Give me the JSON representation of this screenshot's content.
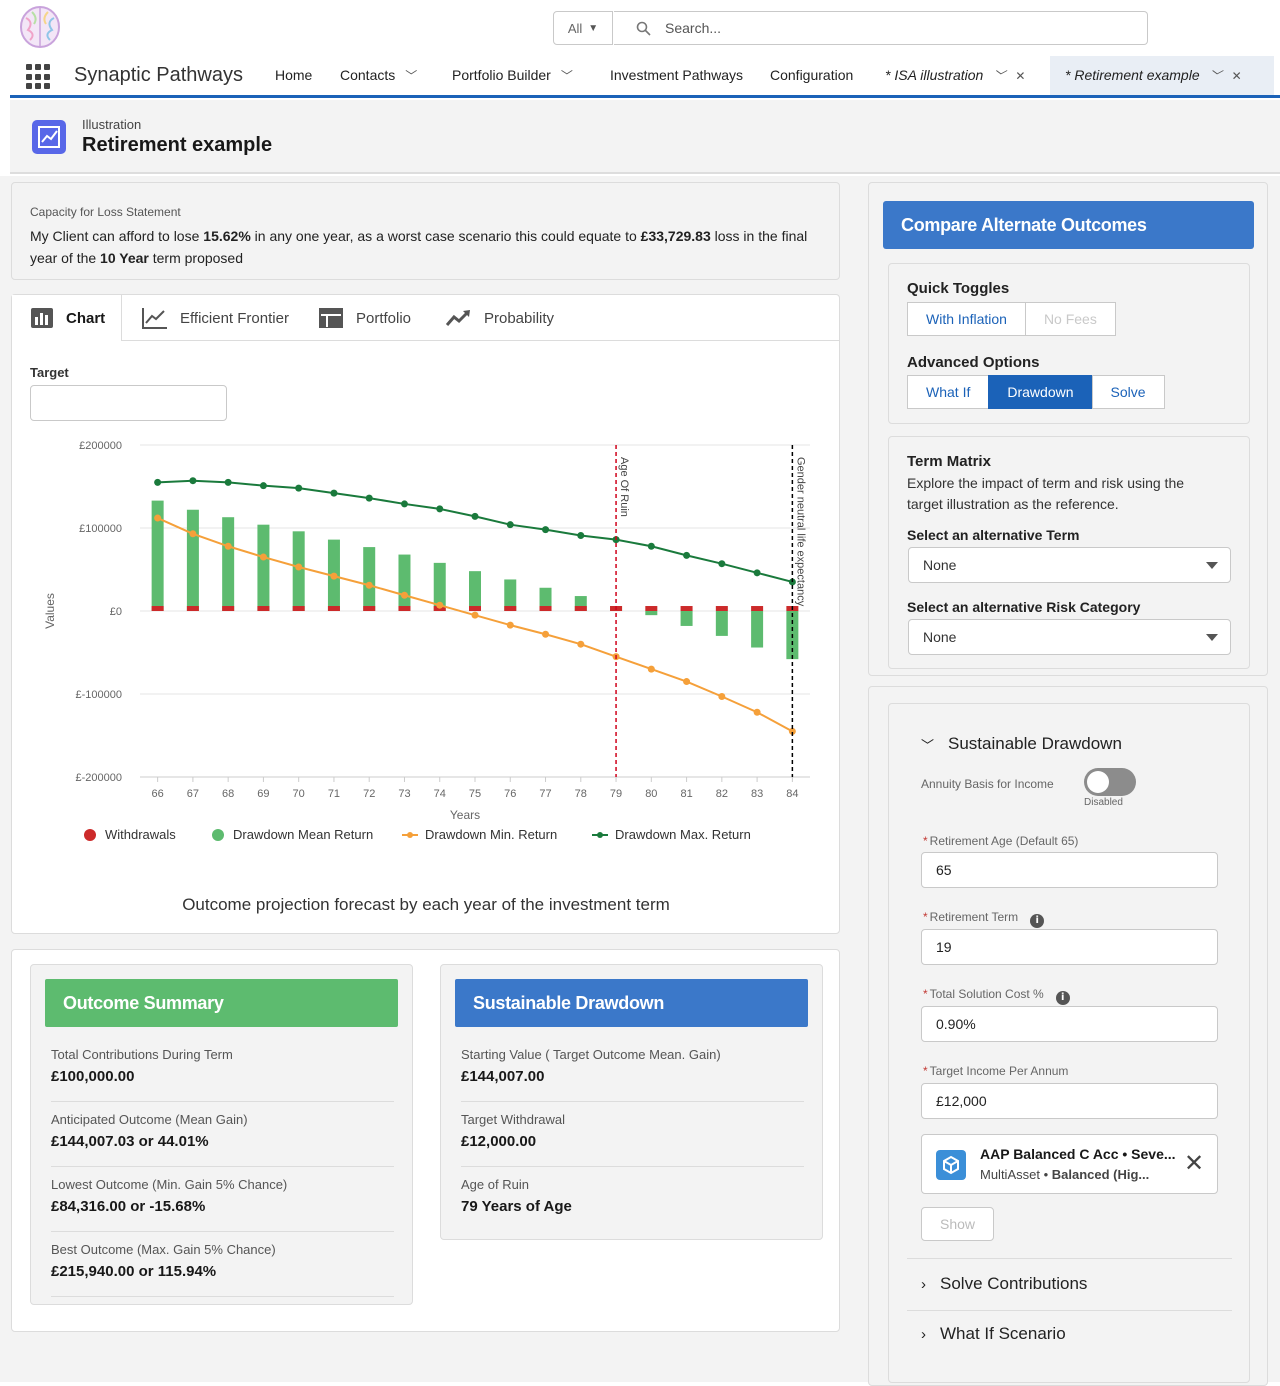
{
  "search": {
    "scope": "All",
    "placeholder": "Search..."
  },
  "nav": {
    "app_name": "Synaptic Pathways",
    "items": [
      {
        "label": "Home"
      },
      {
        "label": "Contacts"
      },
      {
        "label": "Portfolio Builder"
      },
      {
        "label": "Investment Pathways"
      },
      {
        "label": "Configuration"
      },
      {
        "label": "* ISA illustration"
      },
      {
        "label": "* Retirement example"
      }
    ]
  },
  "header": {
    "kicker": "Illustration",
    "title": "Retirement example"
  },
  "capacity": {
    "label": "Capacity for Loss Statement",
    "t1": "My Client can afford to lose ",
    "pct": "15.62%",
    "t2": " in any one year, as a worst case scenario this could equate to ",
    "amount": "£33,729.83",
    "t3": " loss in the final year of the ",
    "term": "10 Year",
    "t4": " term proposed"
  },
  "tabs": [
    {
      "label": "Chart",
      "icon": "bar-chart-icon"
    },
    {
      "label": "Efficient Frontier",
      "icon": "line-chart-icon"
    },
    {
      "label": "Portfolio",
      "icon": "table-icon"
    },
    {
      "label": "Probability",
      "icon": "trend-icon"
    }
  ],
  "target": {
    "label": "Target",
    "value": ""
  },
  "chart_data": {
    "type": "bar",
    "ylabel": "Values",
    "xlabel": "Years",
    "ylim": [
      -200000,
      200000
    ],
    "yticks": [
      200000,
      100000,
      0,
      -100000,
      -200000
    ],
    "ytick_labels": [
      "£200000",
      "£100000",
      "£0",
      "£-100000",
      "£-200000"
    ],
    "x": [
      66,
      67,
      68,
      69,
      70,
      71,
      72,
      73,
      74,
      75,
      76,
      77,
      78,
      79,
      80,
      81,
      82,
      83,
      84
    ],
    "series": [
      {
        "name": "Withdrawals",
        "type": "bar",
        "color": "#cc2a2a",
        "values": [
          6000,
          6000,
          6000,
          6000,
          6000,
          6000,
          6000,
          6000,
          6000,
          6000,
          6000,
          6000,
          6000,
          6000,
          6000,
          6000,
          6000,
          6000,
          6000
        ]
      },
      {
        "name": "Drawdown Mean Return",
        "type": "bar",
        "color": "#5dbb6f",
        "values": [
          133000,
          122000,
          113000,
          104000,
          96000,
          86000,
          77000,
          68000,
          58000,
          48000,
          38000,
          28000,
          18000,
          6000,
          -5000,
          -18000,
          -30000,
          -44000,
          -58000
        ]
      },
      {
        "name": "Drawdown Min. Return",
        "type": "line",
        "color": "#f5a03a",
        "values": [
          112000,
          93000,
          78000,
          65000,
          53000,
          42000,
          31000,
          19000,
          7000,
          -5000,
          -17000,
          -28000,
          -40000,
          -55000,
          -70000,
          -85000,
          -103000,
          -122000,
          -145000
        ]
      },
      {
        "name": "Drawdown Max. Return",
        "type": "line",
        "color": "#1a7a3c",
        "values": [
          155000,
          157000,
          155000,
          151000,
          148000,
          142000,
          136000,
          129000,
          123000,
          114000,
          104000,
          98000,
          91000,
          86000,
          78000,
          67000,
          57000,
          46000,
          35000
        ]
      }
    ],
    "reference_lines": [
      {
        "x": 79,
        "label": "Age Of Ruin",
        "color": "#d0021b"
      },
      {
        "x": 84,
        "label": "Gender neutral life expectancy",
        "color": "#000000"
      }
    ],
    "legend_position": "bottom",
    "grid": true,
    "caption": "Outcome projection forecast by each year of the investment term"
  },
  "outcome_summary": {
    "title": "Outcome Summary",
    "color": "#5dbb6f",
    "items": [
      {
        "label": "Total Contributions During Term",
        "value": "£100,000.00"
      },
      {
        "label": "Anticipated Outcome (Mean Gain)",
        "value": "£144,007.03 or 44.01%"
      },
      {
        "label": "Lowest Outcome (Min. Gain 5% Chance)",
        "value": "£84,316.00 or -15.68%"
      },
      {
        "label": "Best Outcome (Max. Gain 5% Chance)",
        "value": "£215,940.00 or 115.94%"
      }
    ]
  },
  "sustainable_summary": {
    "title": "Sustainable Drawdown",
    "color": "#3b78c9",
    "items": [
      {
        "label": "Starting Value ( Target Outcome Mean. Gain)",
        "value": "£144,007.00"
      },
      {
        "label": "Target Withdrawal",
        "value": "£12,000.00"
      },
      {
        "label": "Age of Ruin",
        "value": "79 Years of Age"
      }
    ]
  },
  "compare": {
    "title": "Compare Alternate Outcomes",
    "quick_toggles": {
      "label": "Quick Toggles",
      "options": [
        "With Inflation",
        "No Fees"
      ]
    },
    "advanced": {
      "label": "Advanced Options",
      "options": [
        "What If",
        "Drawdown",
        "Solve"
      ],
      "selected": "Drawdown"
    },
    "term_matrix": {
      "title": "Term Matrix",
      "desc1": "Explore the impact of term and risk using the",
      "desc2": "target illustration as the reference.",
      "term_label": "Select an alternative Term",
      "term_value": "None",
      "risk_label": "Select an alternative Risk Category",
      "risk_value": "None"
    }
  },
  "drawdown_panel": {
    "title": "Sustainable Drawdown",
    "annuity_label": "Annuity Basis for Income",
    "annuity_state": "Disabled",
    "retirement_age_label": "Retirement Age (Default 65)",
    "retirement_age": "65",
    "retirement_term_label": "Retirement Term",
    "retirement_term": "19",
    "cost_label": "Total Solution Cost %",
    "cost": "0.90%",
    "income_label": "Target Income Per Annum",
    "income": "£12,000",
    "fund_name": "AAP Balanced C Acc • Seve...",
    "fund_sub_1": "MultiAsset • ",
    "fund_sub_2": "Balanced (Hig...",
    "show_label": "Show",
    "solve_label": "Solve Contributions",
    "whatif_label": "What If Scenario"
  }
}
